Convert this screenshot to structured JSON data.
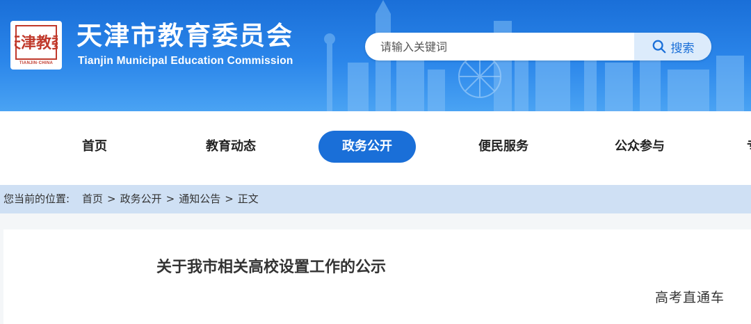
{
  "header": {
    "seal_text": "天津教委",
    "logo_caption": "TIANJIN·CHINA",
    "site_name": "天津市教育委员会",
    "site_name_en": "Tianjin Municipal Education Commission",
    "search": {
      "placeholder": "请输入关键词",
      "button_label": "搜索",
      "icon": "search-icon"
    }
  },
  "nav": {
    "items": [
      {
        "label": "首页",
        "active": false
      },
      {
        "label": "教育动态",
        "active": false
      },
      {
        "label": "政务公开",
        "active": true
      },
      {
        "label": "便民服务",
        "active": false
      },
      {
        "label": "公众参与",
        "active": false
      }
    ],
    "overflow_glyph": "专"
  },
  "breadcrumb": {
    "label": "您当前的位置:",
    "items": [
      "首页",
      "政务公开",
      "通知公告",
      "正文"
    ],
    "separator": ">"
  },
  "article": {
    "title": "关于我市相关高校设置工作的公示"
  },
  "watermark": "高考直通车",
  "colors": {
    "brand_blue": "#1a6fd8",
    "breadcrumb_bg": "#cfe0f4",
    "seal_red": "#c0392b"
  }
}
